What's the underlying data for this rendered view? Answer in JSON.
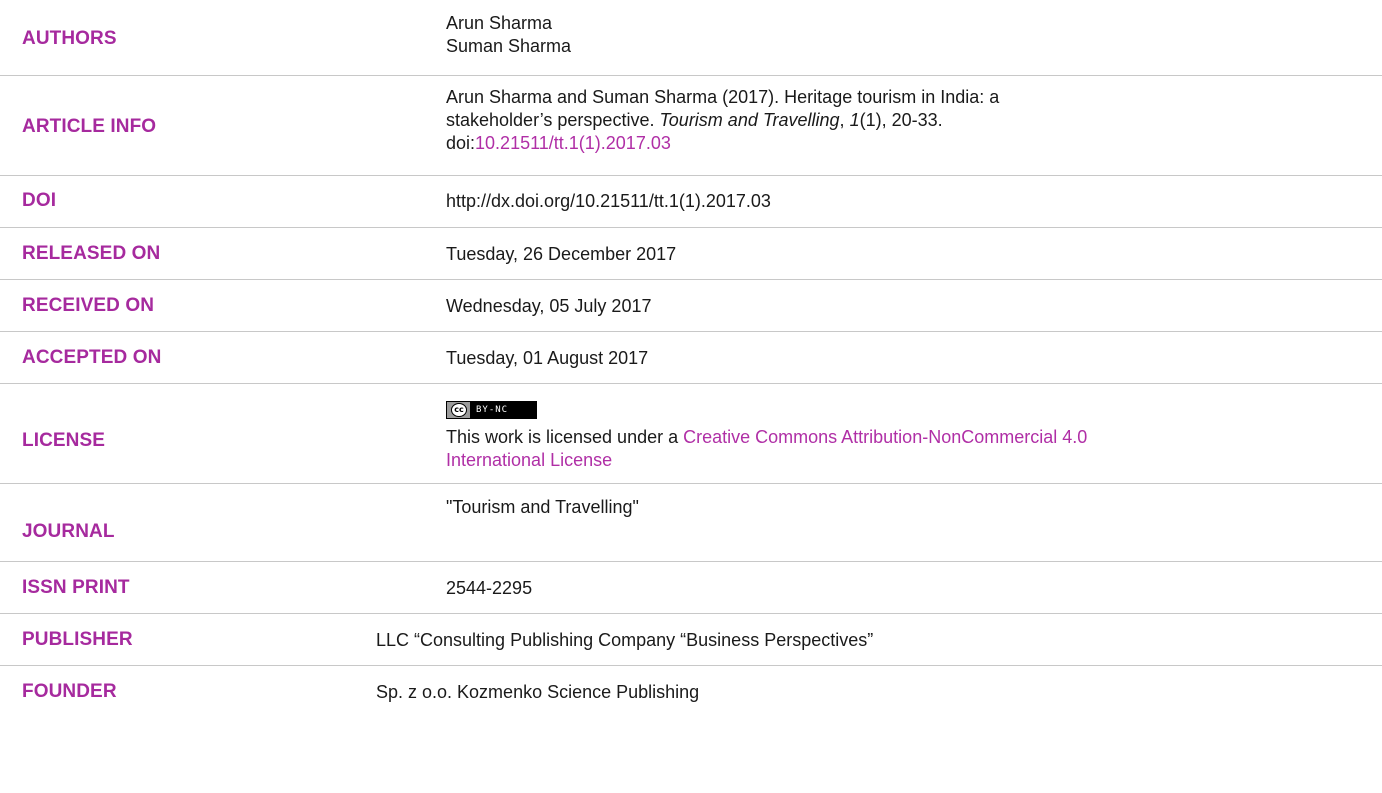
{
  "rows": {
    "authors": {
      "label": "AUTHORS",
      "lines": [
        "Arun Sharma",
        "Suman Sharma"
      ]
    },
    "article_info": {
      "label": "ARTICLE INFO",
      "text_1": "Arun Sharma and Suman Sharma (2017). Heritage tourism in India: a",
      "text_2": "stakeholder’s perspective. ",
      "journal_italic": "Tourism and Travelling",
      "comma": ", ",
      "volume_italic": "1",
      "issue_pages": "(1), 20-33.",
      "doi_prefix": "doi:",
      "doi_link": "10.21511/tt.1(1).2017.03"
    },
    "doi": {
      "label": "DOI",
      "value": "http://dx.doi.org/10.21511/tt.1(1).2017.03"
    },
    "released_on": {
      "label": "RELEASED ON",
      "value": "Tuesday, 26 December 2017"
    },
    "received_on": {
      "label": "RECEIVED ON",
      "value": "Wednesday, 05 July 2017"
    },
    "accepted_on": {
      "label": "ACCEPTED ON",
      "value": "Tuesday, 01 August 2017"
    },
    "license": {
      "label": "LICENSE",
      "badge_cc": "cc",
      "badge_by": "BY-NC",
      "text_prefix": "This work is licensed under a ",
      "link_1": "Creative Commons Attribution-NonCommercial 4.0",
      "link_2": "International License"
    },
    "journal": {
      "label": "JOURNAL",
      "value": "\"Tourism and Travelling\""
    },
    "issn_print": {
      "label": "ISSN PRINT",
      "value": "2544-2295"
    },
    "publisher": {
      "label": "PUBLISHER",
      "value": "LLC “Consulting Publishing Company “Business Perspectives”"
    },
    "founder": {
      "label": "FOUNDER",
      "value": "Sp. z o.o. Kozmenko Science Publishing"
    }
  },
  "colors": {
    "label": "#a62a9e",
    "link": "#b02fa6",
    "divider": "#c8c8c8",
    "text": "#1a1a1a"
  }
}
